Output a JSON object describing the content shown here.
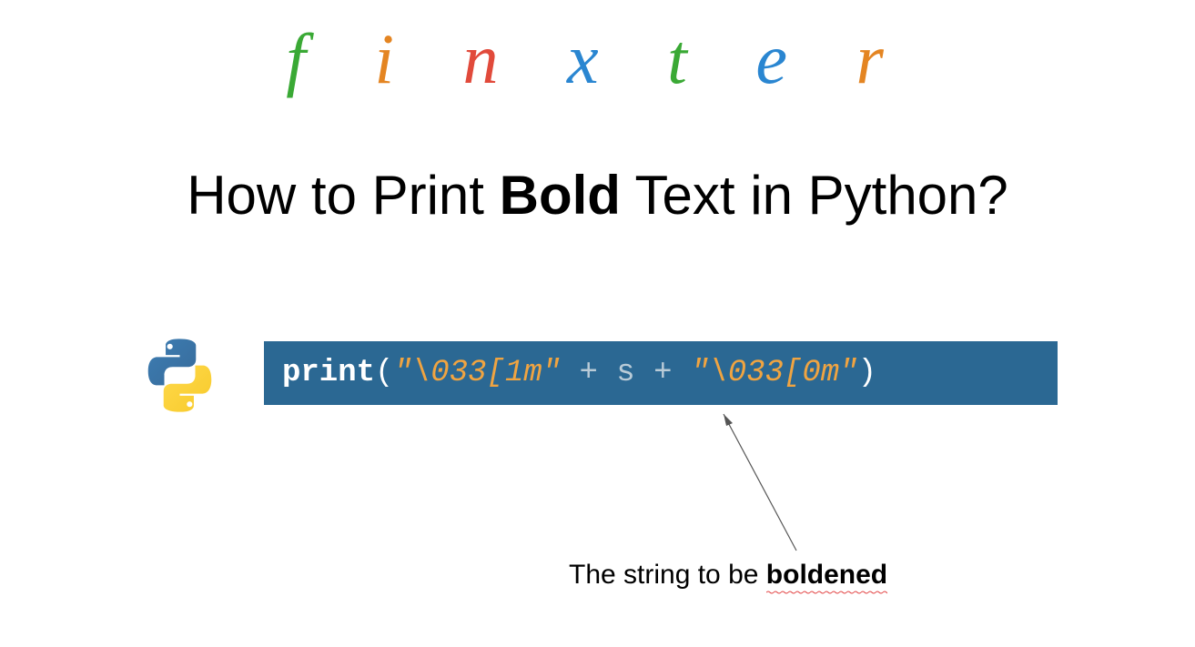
{
  "logo": {
    "letters": [
      "f",
      "i",
      "n",
      "x",
      "t",
      "e",
      "r"
    ],
    "colors": [
      "#3aa935",
      "#e48522",
      "#e14a3b",
      "#2a86d1",
      "#3aa935",
      "#2a86d1",
      "#e48522"
    ]
  },
  "title": {
    "prefix": "How to Print ",
    "bold": "Bold",
    "suffix": " Text in Python?"
  },
  "code": {
    "keyword": "print",
    "open_paren": "(",
    "str1": "\"\\033[1m\"",
    "op1": " + ",
    "var": "s",
    "op2": " + ",
    "str2": "\"\\033[0m\"",
    "close_paren": ")"
  },
  "annotation": {
    "prefix": "The string to be ",
    "bold": "boldened"
  }
}
